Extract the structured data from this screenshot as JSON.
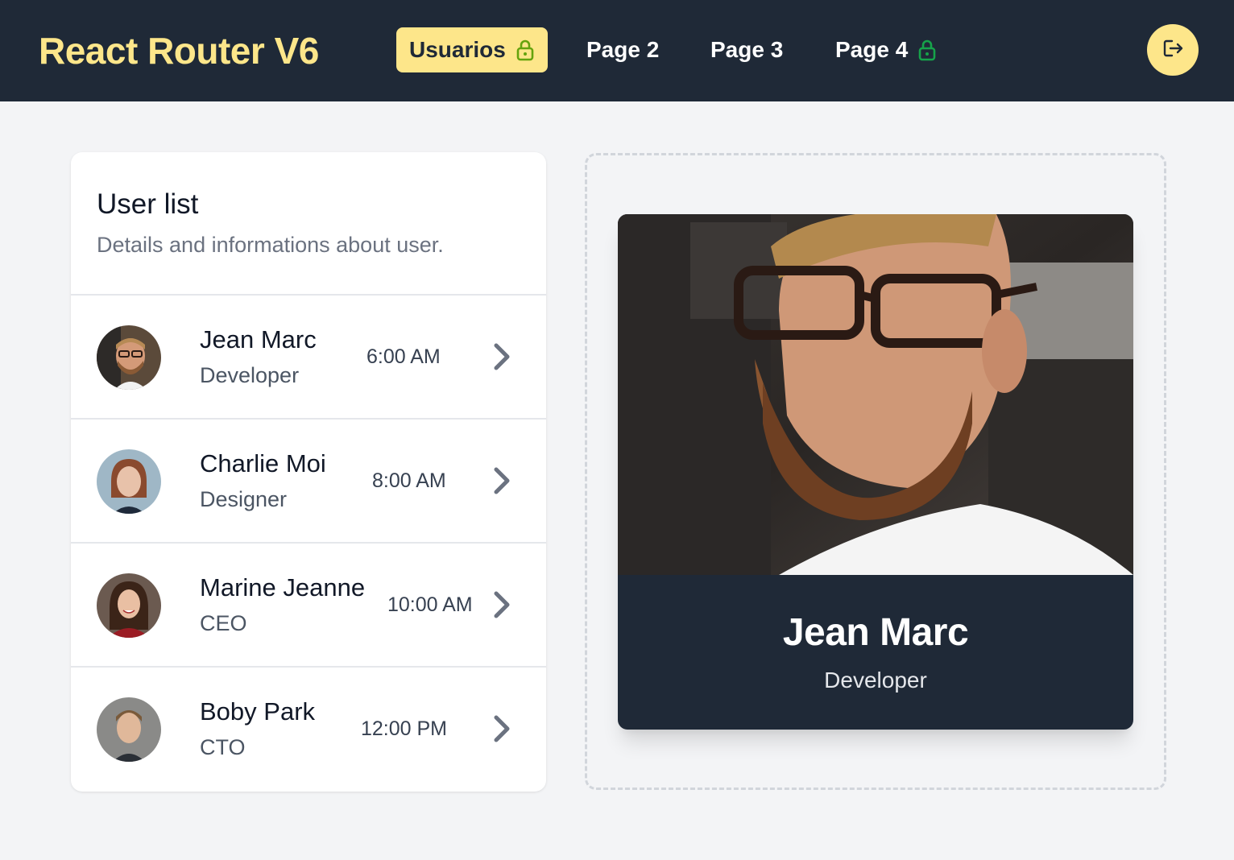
{
  "nav": {
    "brand": "React Router V6",
    "items": [
      {
        "label": "Usuarios",
        "active": true,
        "locked": true
      },
      {
        "label": "Page 2",
        "active": false,
        "locked": false
      },
      {
        "label": "Page 3",
        "active": false,
        "locked": false
      },
      {
        "label": "Page 4",
        "active": false,
        "locked": true
      }
    ],
    "logout_icon": "logout-icon"
  },
  "user_list": {
    "title": "User list",
    "subtitle": "Details and informations about user.",
    "users": [
      {
        "name": "Jean Marc",
        "role": "Developer",
        "time": "6:00 AM"
      },
      {
        "name": "Charlie Moi",
        "role": "Designer",
        "time": "8:00 AM"
      },
      {
        "name": "Marine Jeanne",
        "role": "CEO",
        "time": "10:00 AM"
      },
      {
        "name": "Boby Park",
        "role": "CTO",
        "time": "12:00 PM"
      }
    ]
  },
  "detail": {
    "name": "Jean Marc",
    "role": "Developer"
  },
  "colors": {
    "nav_bg": "#1f2937",
    "accent": "#fde68a",
    "lock_active": "#65a30d",
    "lock_inactive": "#16a34a",
    "page_bg": "#f3f4f6"
  }
}
